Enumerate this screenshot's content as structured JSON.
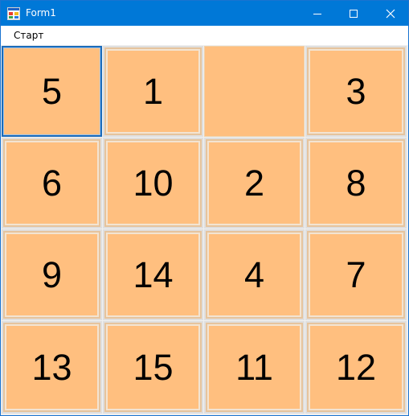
{
  "window": {
    "title": "Form1"
  },
  "menu": {
    "items": [
      {
        "label": "Старт"
      }
    ]
  },
  "board": {
    "tile_color": "#ffbf7f",
    "focus_color": "#1b6bba",
    "tiles": [
      "5",
      "1",
      "",
      "3",
      "6",
      "10",
      "2",
      "8",
      "9",
      "14",
      "4",
      "7",
      "13",
      "15",
      "11",
      "12"
    ]
  }
}
